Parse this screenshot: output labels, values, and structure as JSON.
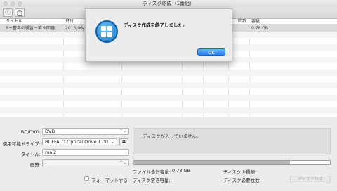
{
  "window": {
    "title": "ディスク作成（1番組）"
  },
  "toolbar": {
    "info_icon": "info-icon",
    "trash_icon": "trash-icon"
  },
  "table": {
    "columns": [
      "タイトル",
      "日付",
      "",
      "",
      "",
      "",
      "回数",
      "容量"
    ],
    "rows": [
      [
        "5－蕾毒の響旨－第９回器",
        "2015/06/",
        "",
        "",
        "",
        "",
        "",
        "0.78 GB"
      ]
    ]
  },
  "dialog": {
    "message": "ディスク作成を終了しました。",
    "ok_label": "OK"
  },
  "form": {
    "media_label": "BD/DVD:",
    "media_value": "DVD",
    "drive_label": "使用可能ドライブ:",
    "drive_value": "BUFFALO Optical Drive 1.00",
    "eject_icon": "eject-icon",
    "title_label": "タイトル:",
    "title_value": "mai2",
    "quality_label": "画質:",
    "quality_value": "-",
    "format_label": "フォーマットする"
  },
  "status": {
    "message": "ディスクが入っていません。",
    "progress": 0.795,
    "total_size_label": "ファイル合計容量:",
    "total_size_value": "0.78 GB",
    "disc_type_label": "ディスクの種類:",
    "free_space_label": "ディスク空き容量:",
    "discs_needed_label": "ディスク必要枚数:"
  },
  "actions": {
    "create_label": "ディスク作成"
  },
  "colors": {
    "accent": "#1d7af0",
    "selection": "#dcdcdc"
  }
}
